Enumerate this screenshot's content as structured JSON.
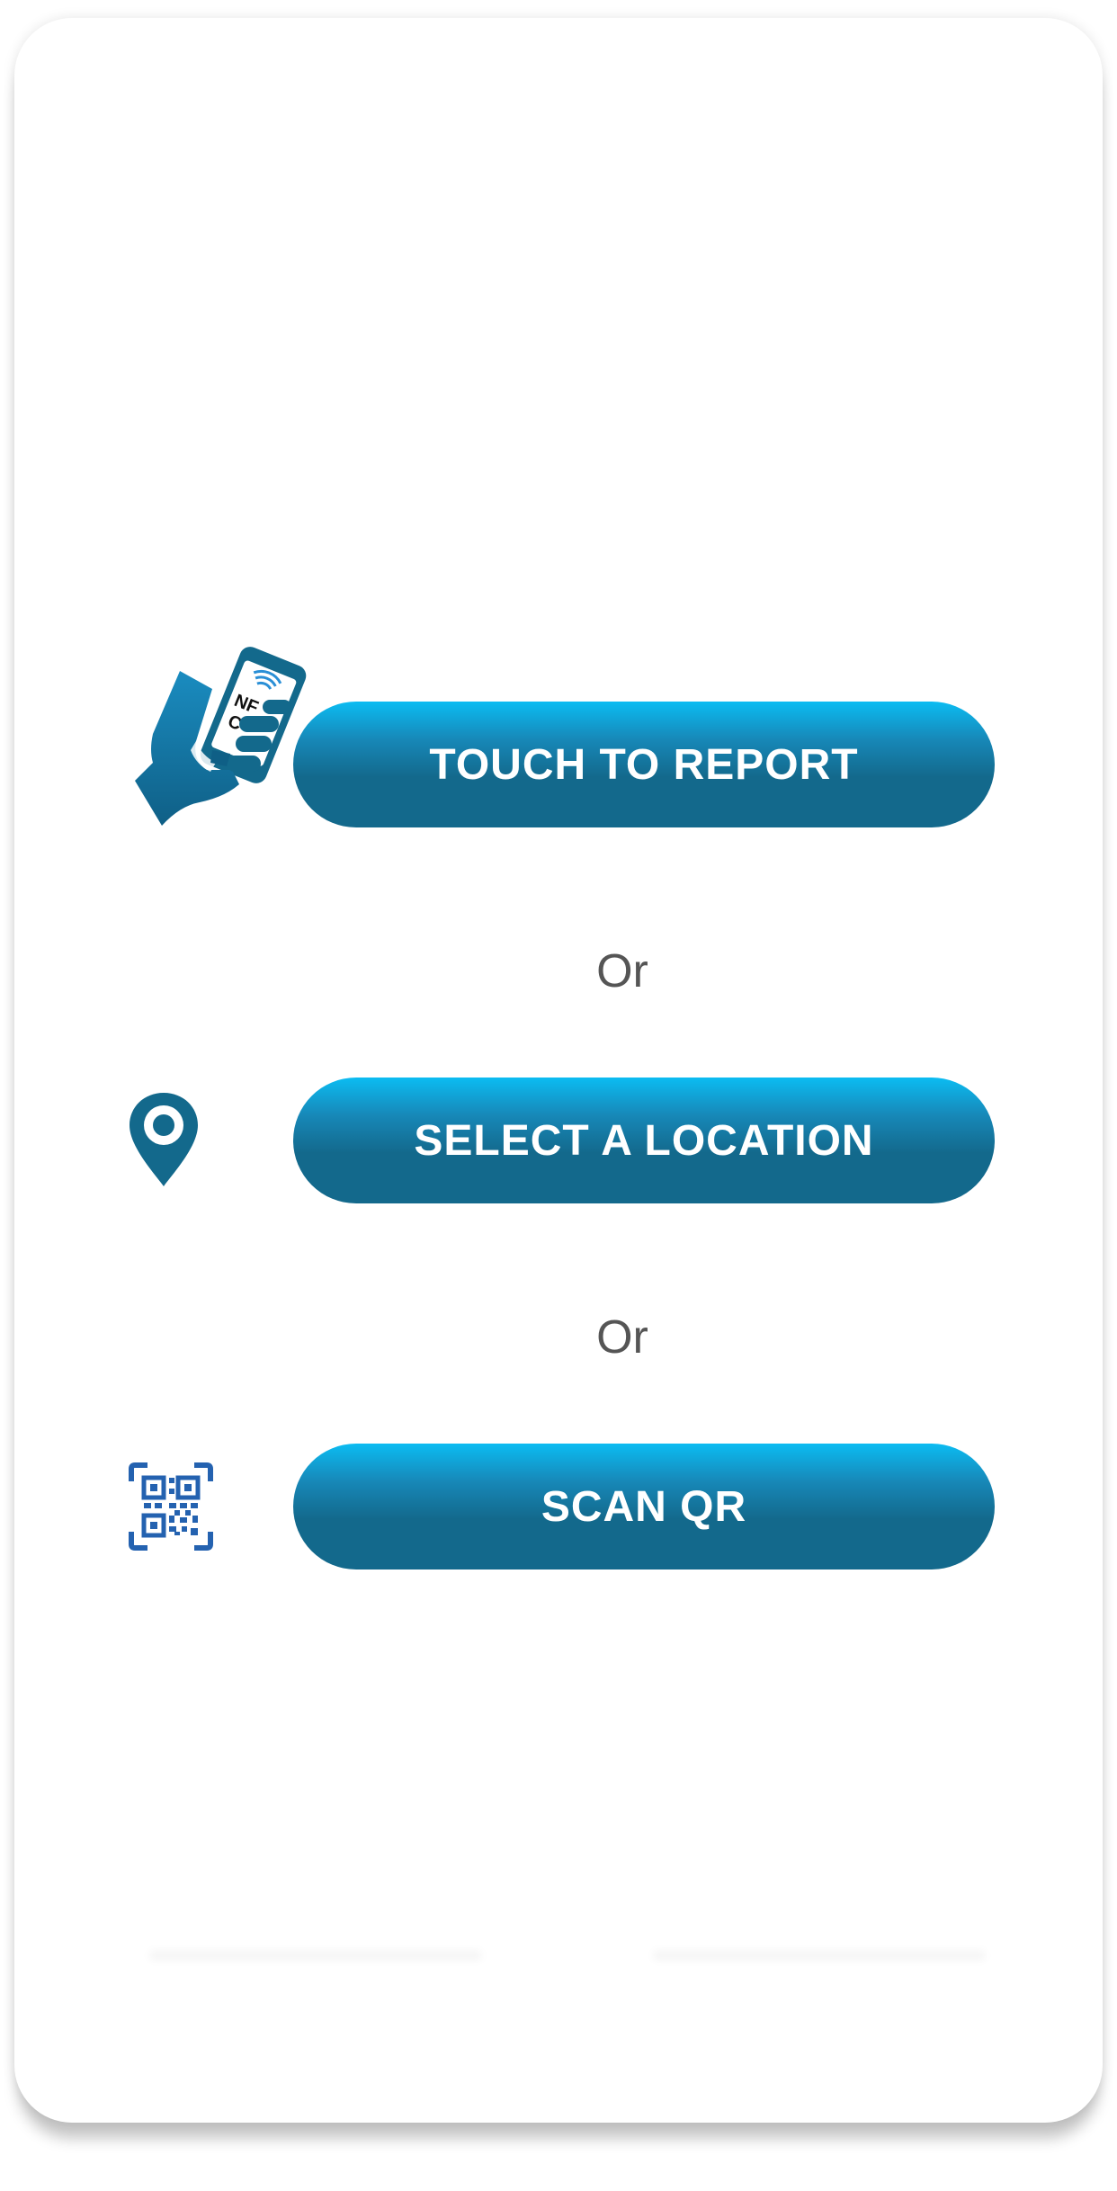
{
  "actions": {
    "touch_to_report": {
      "label": "TOUCH TO REPORT",
      "icon": "nfc-phone-hand-icon",
      "icon_text": "NFC"
    },
    "select_location": {
      "label": "SELECT A LOCATION",
      "icon": "location-pin-icon"
    },
    "scan_qr": {
      "label": "SCAN QR",
      "icon": "qr-code-icon"
    }
  },
  "separators": {
    "first": "Or",
    "second": "Or"
  },
  "colors": {
    "button_top": "#0BBCF2",
    "button_bottom": "#13698C",
    "icon_blue": "#13698C",
    "qr_blue": "#2462B0",
    "separator_text": "#555555",
    "background": "#FFFFFF"
  }
}
